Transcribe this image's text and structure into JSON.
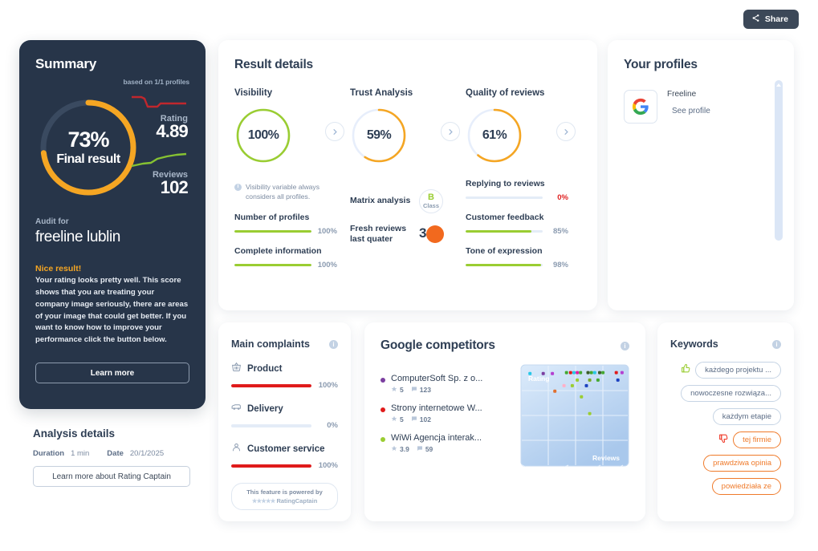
{
  "topbar": {
    "share_label": "Share",
    "share_icon": "share-icon"
  },
  "summary": {
    "title": "Summary",
    "based_on": "based on 1/1 profiles",
    "final_percent": "73%",
    "final_label": "Final result",
    "final_value_num": 73,
    "rating_label": "Rating",
    "rating_value": "4.89",
    "reviews_label": "Reviews",
    "reviews_value": "102",
    "audit_for_label": "Audit for",
    "audit_name": "freeline lublin",
    "verdict_title": "Nice result!",
    "verdict_body": "Your rating looks pretty well. This score shows that you are treating your company image seriously, there are areas of your image that could get better. If you want to know how to improve your performance click the button below.",
    "learn_more_label": "Learn more",
    "accent_orange": "#f5a623",
    "card_bg": "#273549"
  },
  "analysis": {
    "title": "Analysis details",
    "duration_label": "Duration",
    "duration_value": "1 min",
    "date_label": "Date",
    "date_value": "20/1/2025",
    "button_label": "Learn more about Rating Captain"
  },
  "result_details": {
    "title": "Result details",
    "metrics": [
      {
        "caption": "Visibility",
        "value": "100%",
        "percent": 100,
        "color": "#9acd32"
      },
      {
        "caption": "Trust Analysis",
        "value": "59%",
        "percent": 59,
        "color": "#f5a623"
      },
      {
        "caption": "Quality of reviews",
        "value": "61%",
        "percent": 61,
        "color": "#f5a623"
      }
    ],
    "visibility_note": "Visibility variable always considers all profiles.",
    "col1_bars": [
      {
        "label": "Number of profiles",
        "value": "100%",
        "percent": 100,
        "color": "#9acd32"
      },
      {
        "label": "Complete information",
        "value": "100%",
        "percent": 100,
        "color": "#9acd32"
      }
    ],
    "matrix_label": "Matrix analysis",
    "matrix_grade": "B",
    "matrix_grade_sub": "Class",
    "fresh_label": "Fresh reviews last quater",
    "fresh_value": "3",
    "col3_bars": [
      {
        "label": "Replying to reviews",
        "value": "0%",
        "percent": 0,
        "color": "#9acd32",
        "negative": true
      },
      {
        "label": "Customer feedback",
        "value": "85%",
        "percent": 85,
        "color": "#9acd32",
        "negative": false
      },
      {
        "label": "Tone of expression",
        "value": "98%",
        "percent": 98,
        "color": "#9acd32",
        "negative": false
      }
    ]
  },
  "your_profiles": {
    "title": "Your profiles",
    "profile_name": "Freeline",
    "see_profile_label": "See profile",
    "provider_icon": "google-icon"
  },
  "main_complaints": {
    "title": "Main complaints",
    "items": [
      {
        "label": "Product",
        "value": "100%",
        "percent": 100,
        "icon": "basket-icon"
      },
      {
        "label": "Delivery",
        "value": "0%",
        "percent": 0,
        "icon": "truck-icon"
      },
      {
        "label": "Customer service",
        "value": "100%",
        "percent": 100,
        "icon": "person-icon"
      }
    ],
    "powered_line1": "This feature is powered by",
    "powered_stars": "★★★★★",
    "powered_brand": "RatingCaptain",
    "bar_color": "#e01b1b"
  },
  "google_competitors": {
    "title": "Google competitors",
    "items": [
      {
        "name": "ComputerSoft Sp. z o...",
        "rating": "5",
        "reviews": "123",
        "color": "#7b3fa0"
      },
      {
        "name": "Strony internetowe W...",
        "rating": "5",
        "reviews": "102",
        "color": "#e01b1b"
      },
      {
        "name": "WiWi Agencja interak...",
        "rating": "3.9",
        "reviews": "59",
        "color": "#9acd32"
      }
    ],
    "chart_data": {
      "type": "scatter",
      "title": "",
      "xlabel": "Reviews",
      "ylabel": "Rating",
      "grid": true,
      "legend": "none",
      "xlim": [
        0,
        100
      ],
      "ylim": [
        0,
        100
      ],
      "points": [
        {
          "x": 6,
          "y": 95,
          "color": "#28c8e8"
        },
        {
          "x": 22,
          "y": 95,
          "color": "#7b3fa0"
        },
        {
          "x": 33,
          "y": 95,
          "color": "#b43fd0"
        },
        {
          "x": 50,
          "y": 96,
          "color": "#44a832"
        },
        {
          "x": 55,
          "y": 96,
          "color": "#e01b1b"
        },
        {
          "x": 59,
          "y": 96,
          "color": "#28c8e8"
        },
        {
          "x": 63,
          "y": 96,
          "color": "#e020a0"
        },
        {
          "x": 67,
          "y": 96,
          "color": "#44a832"
        },
        {
          "x": 76,
          "y": 96,
          "color": "#3c5c2a"
        },
        {
          "x": 80,
          "y": 96,
          "color": "#44a832"
        },
        {
          "x": 84,
          "y": 96,
          "color": "#28c8e8"
        },
        {
          "x": 90,
          "y": 96,
          "color": "#3c5c2a"
        },
        {
          "x": 94,
          "y": 96,
          "color": "#44a832"
        },
        {
          "x": 63,
          "y": 88,
          "color": "#9acd32"
        },
        {
          "x": 78,
          "y": 88,
          "color": "#7aa828"
        },
        {
          "x": 88,
          "y": 88,
          "color": "#44a832"
        },
        {
          "x": 47,
          "y": 82,
          "color": "#ffb0c8"
        },
        {
          "x": 57,
          "y": 82,
          "color": "#9acd32"
        },
        {
          "x": 74,
          "y": 82,
          "color": "#1a40c0"
        },
        {
          "x": 36,
          "y": 76,
          "color": "#e07030"
        },
        {
          "x": 68,
          "y": 70,
          "color": "#9acd32"
        },
        {
          "x": 78,
          "y": 52,
          "color": "#9acd32"
        },
        {
          "x": 110,
          "y": 96,
          "color": "#e01b1b"
        },
        {
          "x": 117,
          "y": 96,
          "color": "#b43fd0"
        },
        {
          "x": 112,
          "y": 88,
          "color": "#1a40c0"
        }
      ]
    }
  },
  "keywords": {
    "title": "Keywords",
    "items": [
      {
        "text": "każdego projektu ...",
        "sentiment": "positive",
        "icon": "thumbs-up-icon"
      },
      {
        "text": "nowoczesne rozwiąza...",
        "sentiment": "neutral",
        "icon": ""
      },
      {
        "text": "każdym etapie",
        "sentiment": "neutral",
        "icon": ""
      },
      {
        "text": "tej firmie",
        "sentiment": "negative",
        "icon": "thumbs-down-icon"
      },
      {
        "text": "prawdziwa opinia",
        "sentiment": "negative",
        "icon": ""
      },
      {
        "text": "powiedziała ze",
        "sentiment": "negative",
        "icon": ""
      }
    ],
    "positive_color": "#9acd32",
    "negative_color": "#ef7a2a"
  }
}
